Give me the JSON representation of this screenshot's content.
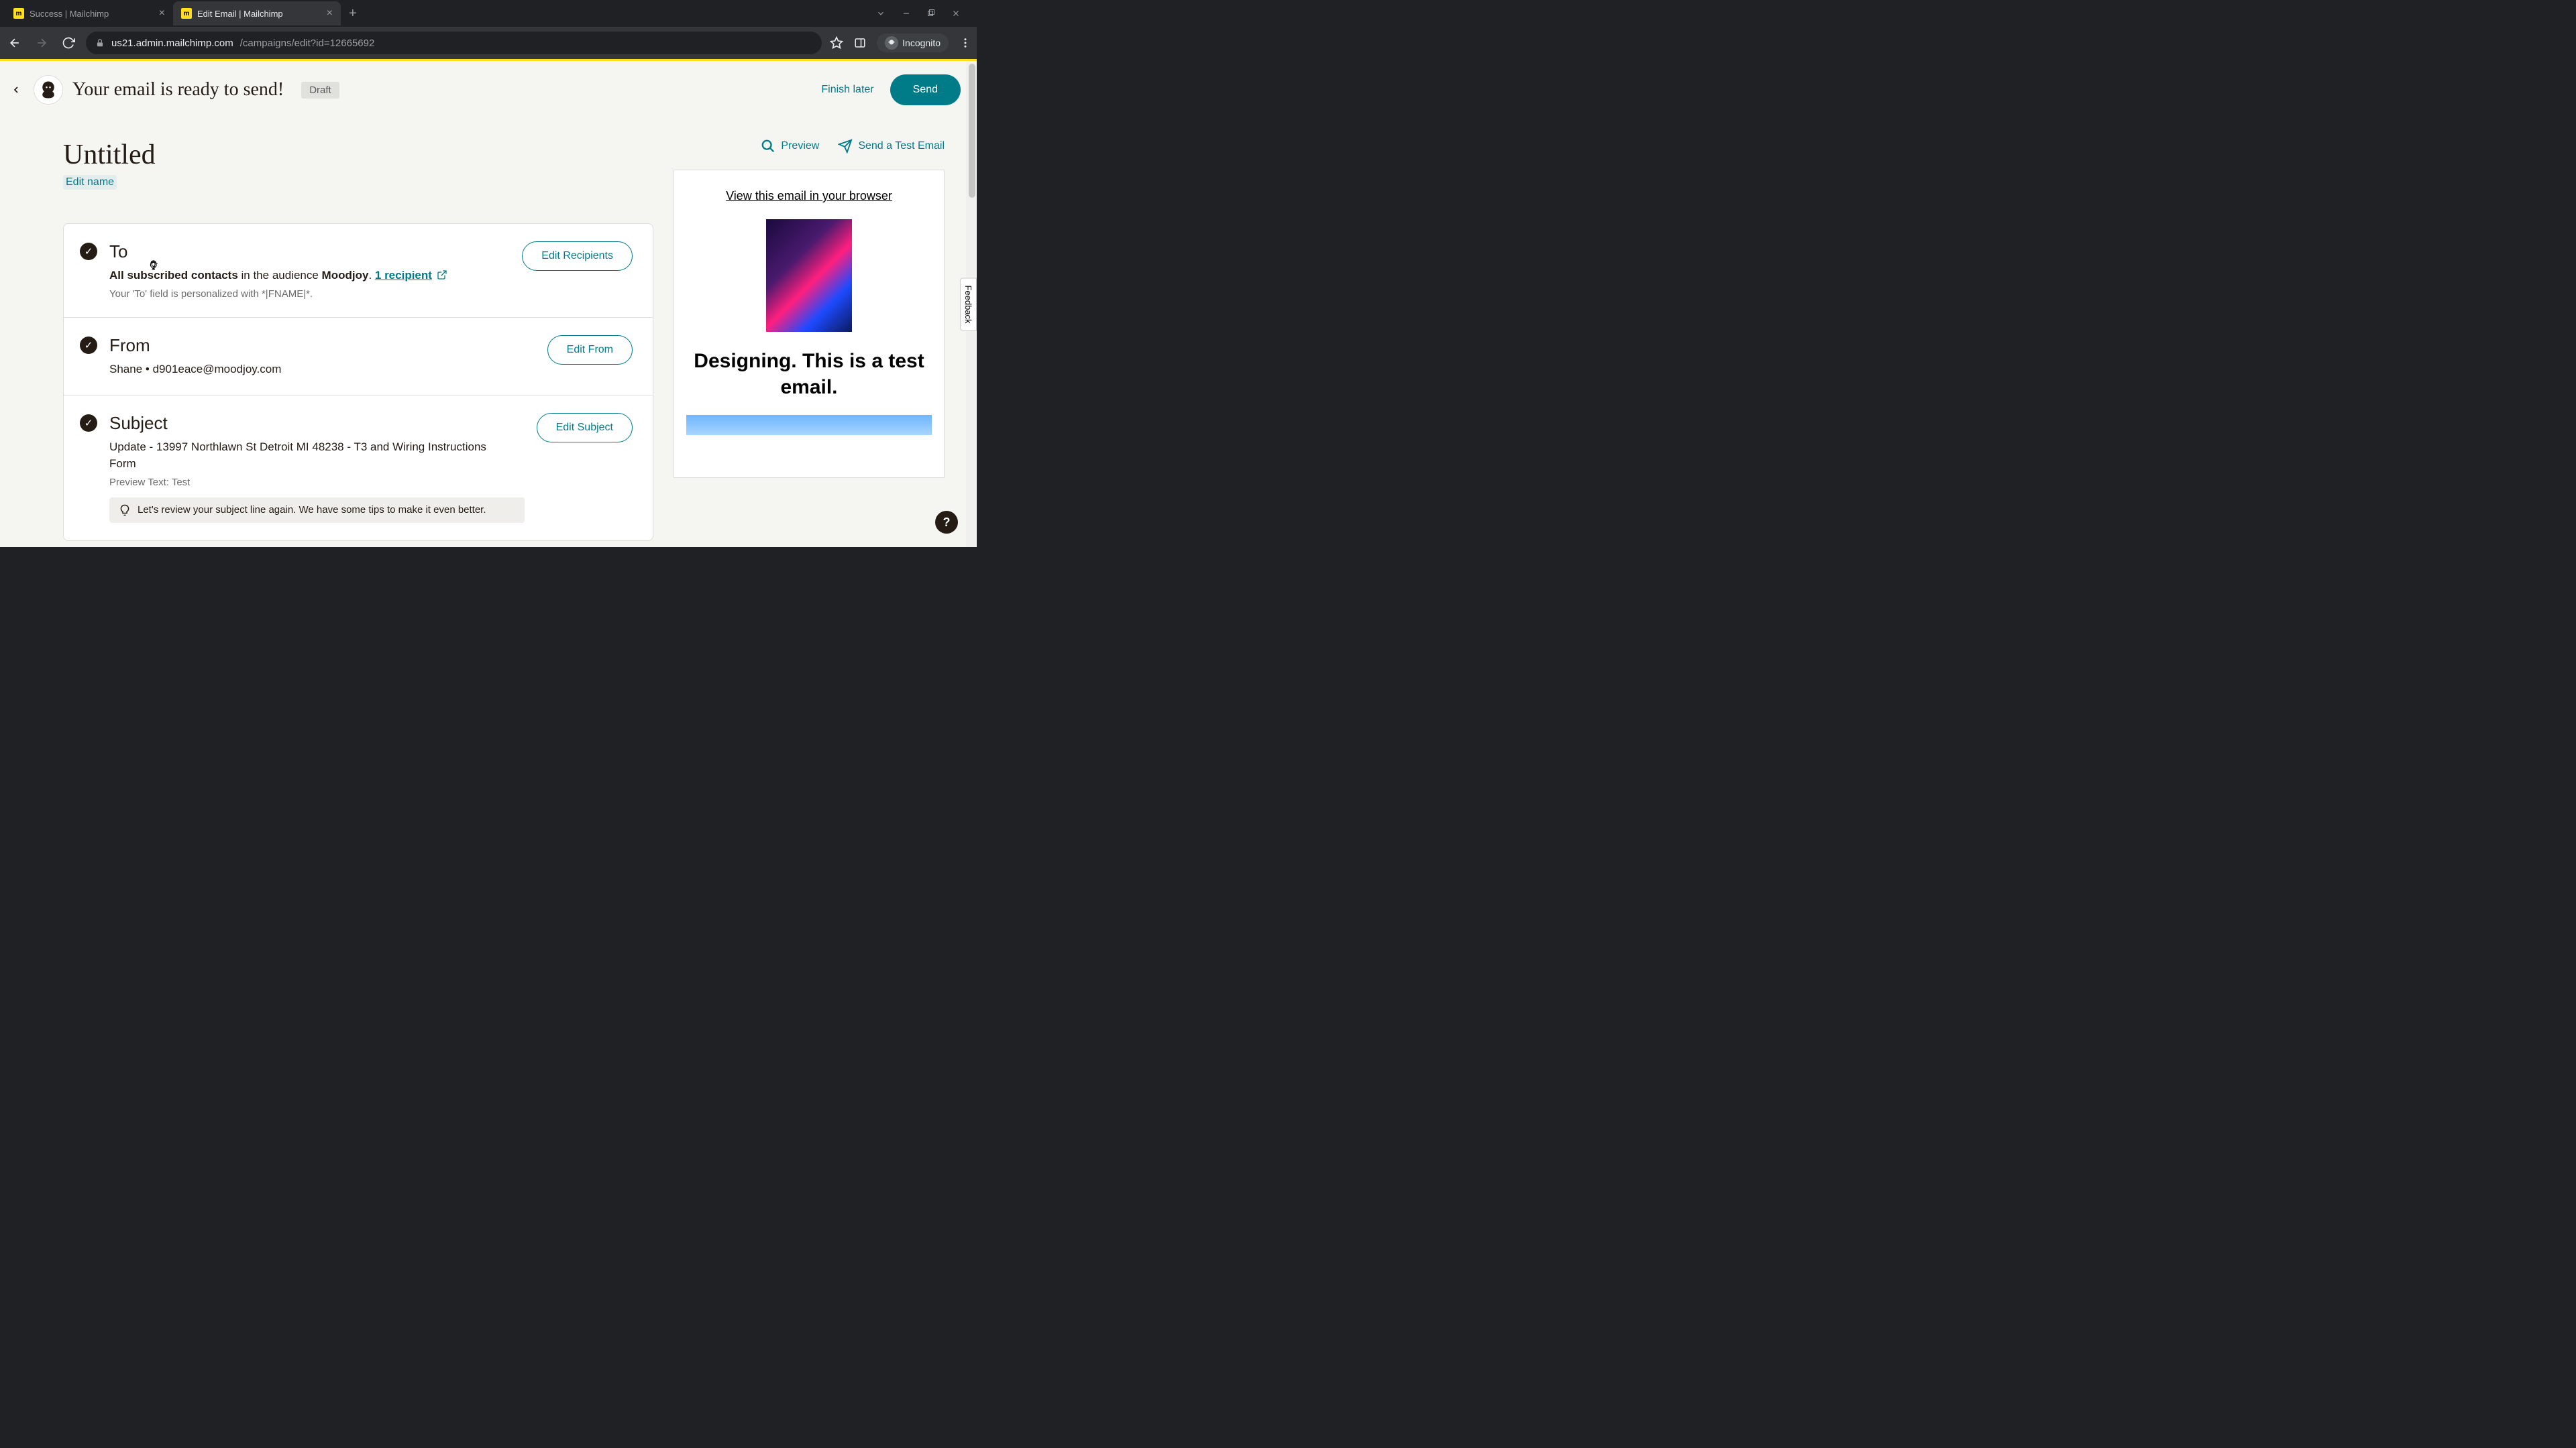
{
  "browser": {
    "tabs": [
      {
        "title": "Success | Mailchimp"
      },
      {
        "title": "Edit Email | Mailchimp"
      }
    ],
    "url_host": "us21.admin.mailchimp.com",
    "url_path": "/campaigns/edit?id=12665692",
    "incognito_label": "Incognito"
  },
  "header": {
    "ready_text": "Your email is ready to send!",
    "status_badge": "Draft",
    "finish_later": "Finish later",
    "send": "Send"
  },
  "campaign": {
    "name": "Untitled",
    "edit_name": "Edit name"
  },
  "sections": {
    "to": {
      "title": "To",
      "strong1": "All subscribed contacts",
      "mid": " in the audience ",
      "strong2": "Moodjoy",
      "period": ".  ",
      "recipient_link": "1 recipient",
      "sub": "Your 'To' field is personalized with *|FNAME|*.",
      "button": "Edit Recipients"
    },
    "from": {
      "title": "From",
      "name": "Shane",
      "sep": "  •  ",
      "email": "d901eace@moodjoy.com",
      "button": "Edit From"
    },
    "subject": {
      "title": "Subject",
      "text": "Update - 13997 Northlawn St Detroit MI 48238 - T3 and Wiring Instructions Form",
      "preview_label": "Preview Text: Test",
      "tip": "Let's review your subject line again. We have some tips to make it even better.",
      "button": "Edit Subject"
    }
  },
  "right": {
    "preview": "Preview",
    "send_test": "Send a Test Email",
    "view_browser": "View this email in your browser",
    "heading": "Designing. This is a test email."
  },
  "misc": {
    "feedback": "Feedback",
    "help": "?"
  }
}
